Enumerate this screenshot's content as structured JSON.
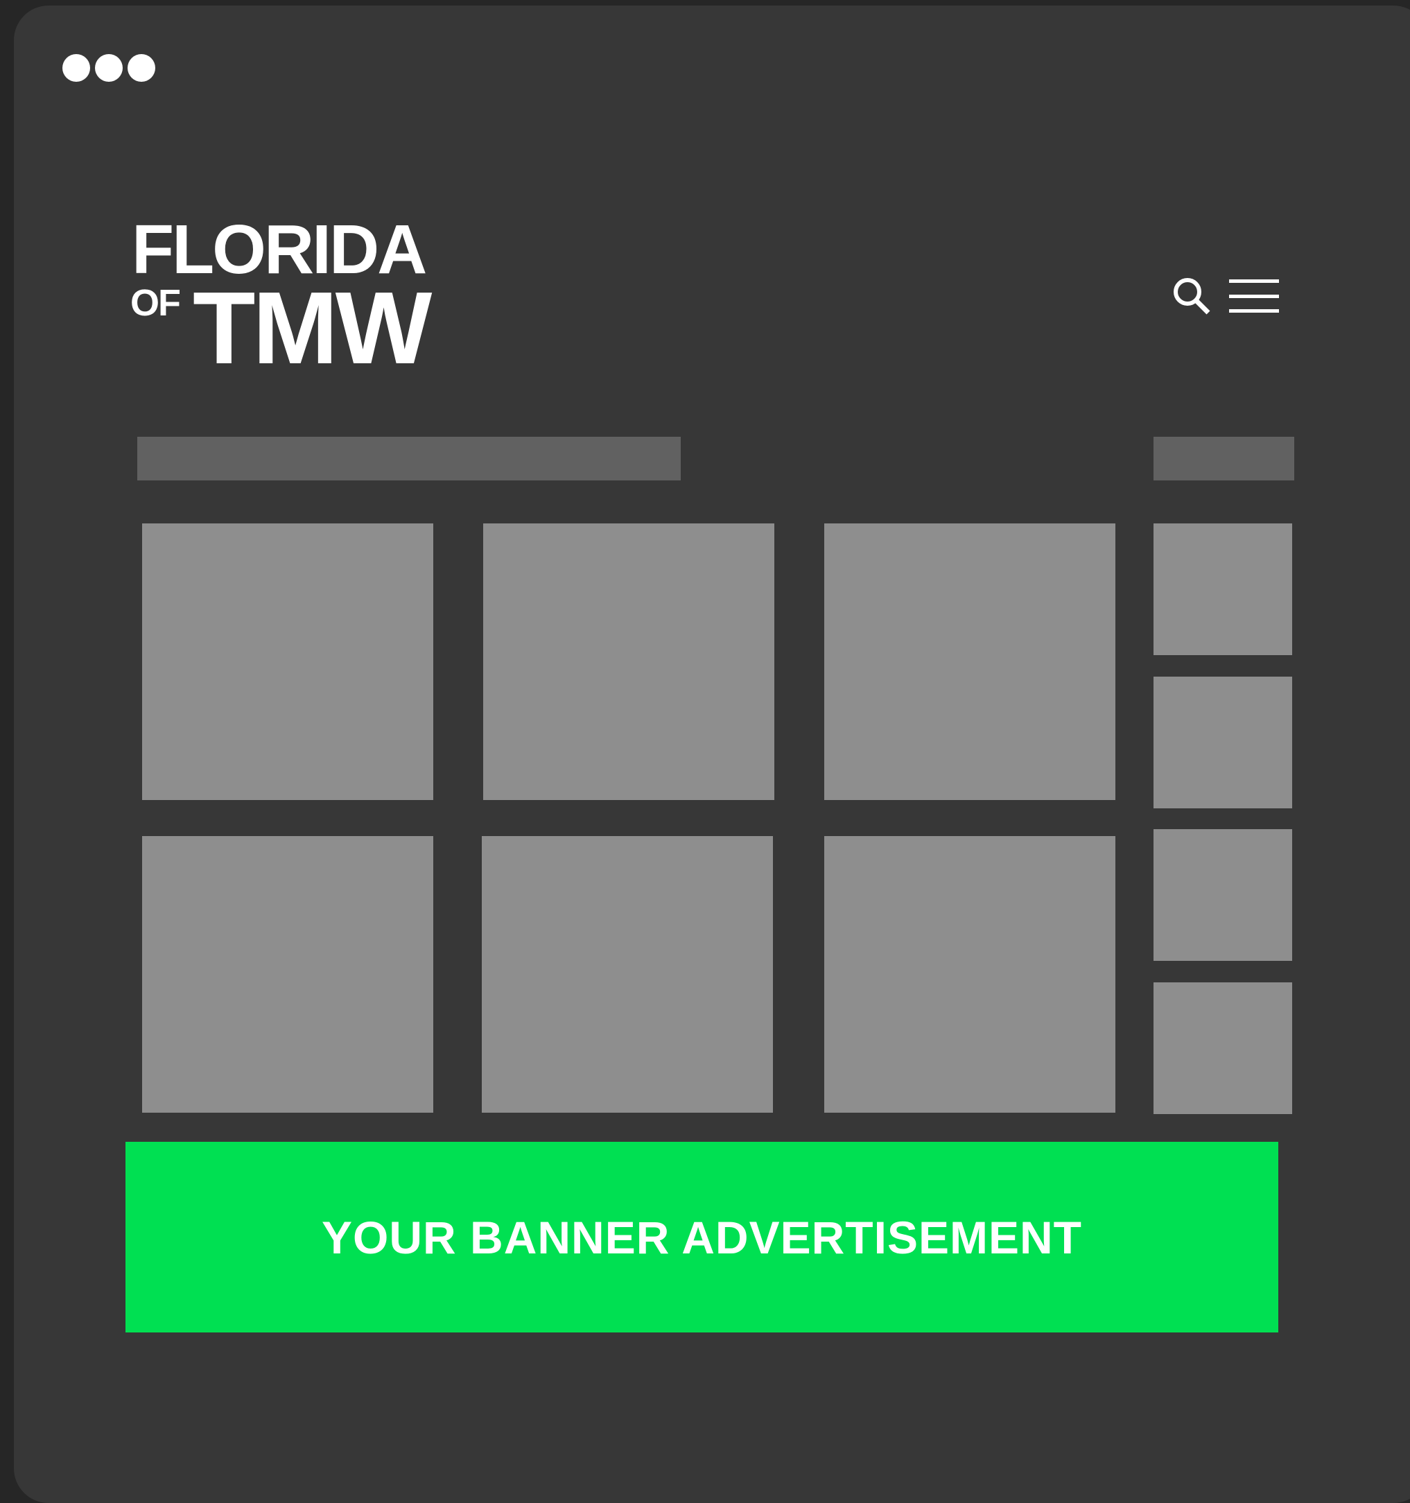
{
  "window": {
    "controls": [
      "dot",
      "dot",
      "dot"
    ]
  },
  "header": {
    "logo": {
      "line1": "FLORIDA",
      "small": "OF",
      "line2": "TMW"
    },
    "icons": [
      "search-icon",
      "menu-icon"
    ]
  },
  "banner": {
    "label": "YOUR BANNER ADVERTISEMENT",
    "color": "#00e052"
  },
  "colors": {
    "background": "#262626",
    "window": "#373737",
    "placeholder_bar": "#616161",
    "placeholder_tile": "#8e8e8e",
    "text": "#ffffff"
  }
}
